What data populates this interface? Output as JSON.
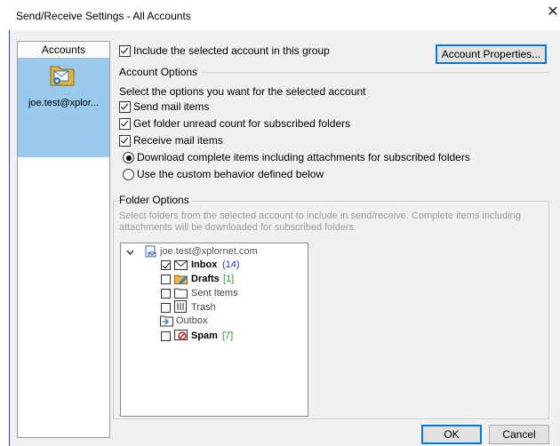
{
  "window": {
    "title": "Send/Receive Settings - All Accounts"
  },
  "accounts": {
    "header": "Accounts",
    "selected": "joe.test@xplor..."
  },
  "include_checkbox": {
    "label": "Include the selected account in this group",
    "checked": true
  },
  "buttons": {
    "account_properties": "Account Properties...",
    "ok": "OK",
    "cancel": "Cancel"
  },
  "account_options": {
    "title": "Account Options",
    "description": "Select the options you want for the selected account",
    "send_mail": {
      "label": "Send mail items",
      "checked": true
    },
    "unread_count": {
      "label": "Get folder unread count for subscribed folders",
      "checked": true
    },
    "receive_mail": {
      "label": "Receive mail items",
      "checked": true
    },
    "download_radio": {
      "label": "Download complete items including attachments for subscribed folders",
      "selected": true
    },
    "custom_radio": {
      "label": "Use the custom behavior defined below",
      "selected": false
    }
  },
  "folder_options": {
    "title": "Folder Options",
    "description": "Select folders from the selected account to include in send/receive. Complete items including attachments will be downloaded for subscribed folders.",
    "tree": {
      "root": "joe.test@xplornet.com",
      "folders": [
        {
          "name": "Inbox",
          "count": "(14)",
          "checked": true,
          "bold": true,
          "count_color": "#1a3fd6"
        },
        {
          "name": "Drafts",
          "count": "[1]",
          "checked": false,
          "bold": true,
          "count_color": "#2a9a2a"
        },
        {
          "name": "Sent Items",
          "count": "",
          "checked": false,
          "bold": false
        },
        {
          "name": "Trash",
          "count": "",
          "checked": false,
          "bold": false
        },
        {
          "name": "Outbox",
          "count": "",
          "checked": false,
          "bold": false,
          "no_checkbox": true
        },
        {
          "name": "Spam",
          "count": "[7]",
          "checked": false,
          "bold": true,
          "count_color": "#2a9a2a"
        }
      ]
    }
  },
  "icons": [
    "close-icon",
    "account-icon",
    "expand-chevron-icon",
    "mailbox-icon",
    "mail-icon",
    "drafts-icon",
    "folder-icon",
    "trash-icon",
    "outbox-icon",
    "spam-icon"
  ]
}
